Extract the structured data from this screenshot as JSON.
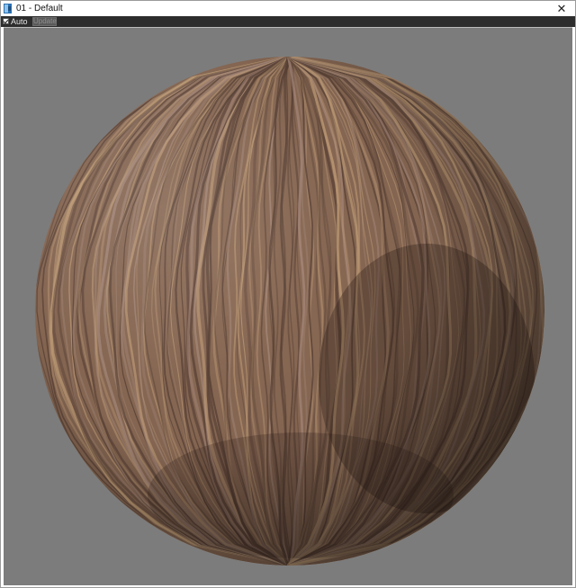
{
  "window": {
    "title": "01 - Default",
    "close_glyph": "✕"
  },
  "toolbar": {
    "auto_label": "Auto",
    "auto_checked": true,
    "update_label": "Update"
  },
  "viewport": {
    "background_color": "#7c7c7c",
    "preview_object": "sphere",
    "material_colors": {
      "base": "#8a6a55",
      "grain_light": "#c4a079",
      "grain_dark": "#5a4236"
    }
  },
  "icons": {
    "app": "material-editor-icon",
    "close": "close-icon"
  }
}
